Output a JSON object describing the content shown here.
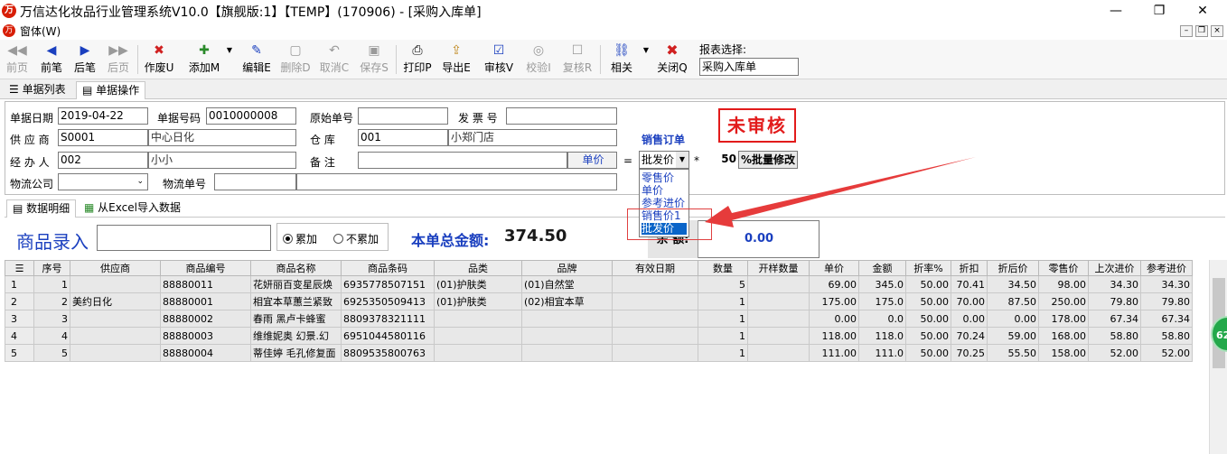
{
  "window": {
    "title": "万信达化妆品行业管理系统V10.0【旗舰版:1】【TEMP】(170906) - [采购入库单]",
    "menu": "窗体(W)"
  },
  "toolbar": {
    "buttons": [
      {
        "label": "前页",
        "enabled": false
      },
      {
        "label": "前笔",
        "enabled": true
      },
      {
        "label": "后笔",
        "enabled": true
      },
      {
        "label": "后页",
        "enabled": false
      },
      {
        "label": "作废U",
        "enabled": true
      },
      {
        "label": "添加M",
        "enabled": true
      },
      {
        "label": "编辑E",
        "enabled": true
      },
      {
        "label": "删除D",
        "enabled": false
      },
      {
        "label": "取消C",
        "enabled": false
      },
      {
        "label": "保存S",
        "enabled": false
      },
      {
        "label": "打印P",
        "enabled": true
      },
      {
        "label": "导出E",
        "enabled": true
      },
      {
        "label": "审核V",
        "enabled": true
      },
      {
        "label": "校验I",
        "enabled": false
      },
      {
        "label": "复核R",
        "enabled": false
      },
      {
        "label": "相关",
        "enabled": true
      },
      {
        "label": "关闭Q",
        "enabled": true
      }
    ],
    "report_label": "报表选择:",
    "report_value": "采购入库单"
  },
  "tabs": {
    "list": "单据列表",
    "operate": "单据操作"
  },
  "form": {
    "date_label": "单据日期",
    "date_value": "2019-04-22",
    "no_label": "单据号码",
    "no_value": "0010000008",
    "orig_label": "原始单号",
    "orig_value": "",
    "invoice_label": "发 票 号",
    "invoice_value": "",
    "supplier_label": "供 应 商",
    "supplier_code": "S0001",
    "supplier_name": "中心日化",
    "warehouse_label": "仓    库",
    "warehouse_code": "001",
    "warehouse_name": "小郑门店",
    "handler_label": "经 办 人",
    "handler_code": "002",
    "handler_name": "小小",
    "remark_label": "备    注",
    "remark_value": "",
    "unitprice_btn": "单价",
    "equals": "=",
    "price_type": "批发价",
    "times": "*",
    "percent": "50",
    "batch_btn": "%批量修改",
    "logistics_label": "物流公司",
    "logistics_no_label": "物流单号",
    "sales_order": "销售订单",
    "status_stamp": "未审核"
  },
  "dropdown": {
    "options": [
      "零售价",
      "单价",
      "参考进价",
      "销售价1",
      "批发价"
    ],
    "selected": "批发价"
  },
  "tabs2": {
    "detail": "数据明细",
    "excel": "从Excel导入数据"
  },
  "entry": {
    "title": "商品录入",
    "radio_accumulate": "累加",
    "radio_no_accumulate": "不累加",
    "total_label": "本单总金额:",
    "total_value": "374.50",
    "balance_label": "余  额:",
    "balance_value": "0.00"
  },
  "table": {
    "headers": [
      "序号",
      "供应商",
      "商品编号",
      "商品名称",
      "商品条码",
      "品类",
      "品牌",
      "有效日期",
      "数量",
      "开样数量",
      "单价",
      "金额",
      "折率%",
      "折扣",
      "折后价",
      "零售价",
      "上次进价",
      "参考进价"
    ],
    "rows": [
      [
        "1",
        "",
        "88880011",
        "花妍丽百变星辰焕",
        "6935778507151",
        "(01)护肤类",
        "(01)自然堂",
        "",
        "5",
        "",
        "69.00",
        "345.0",
        "50.00",
        "70.41",
        "34.50",
        "98.00",
        "34.30",
        "34.30"
      ],
      [
        "2",
        "美约日化",
        "88880001",
        "相宜本草蕙兰紧致",
        "6925350509413",
        "(01)护肤类",
        "(02)相宜本草",
        "",
        "1",
        "",
        "175.00",
        "175.0",
        "50.00",
        "70.00",
        "87.50",
        "250.00",
        "79.80",
        "79.80"
      ],
      [
        "3",
        "",
        "88880002",
        "春雨  黑卢卡蜂蜜",
        "8809378321111",
        "",
        "",
        "",
        "1",
        "",
        "0.00",
        "0.0",
        "50.00",
        "0.00",
        "0.00",
        "178.00",
        "67.34",
        "67.34"
      ],
      [
        "4",
        "",
        "88880003",
        "维维妮奥 幻景.幻",
        "6951044580116",
        "",
        "",
        "",
        "1",
        "",
        "118.00",
        "118.0",
        "50.00",
        "70.24",
        "59.00",
        "168.00",
        "58.80",
        "58.80"
      ],
      [
        "5",
        "",
        "88880004",
        "蒂佳婷 毛孔修复面",
        "8809535800763",
        "",
        "",
        "",
        "1",
        "",
        "111.00",
        "111.0",
        "50.00",
        "70.25",
        "55.50",
        "158.00",
        "52.00",
        "52.00"
      ]
    ],
    "row_headers": [
      "1",
      "2",
      "3",
      "4",
      "5"
    ]
  },
  "badge": "62",
  "colors": {
    "accent": "#1a3fbf",
    "stamp": "#e21b1b",
    "arrow": "#e63b3b"
  }
}
